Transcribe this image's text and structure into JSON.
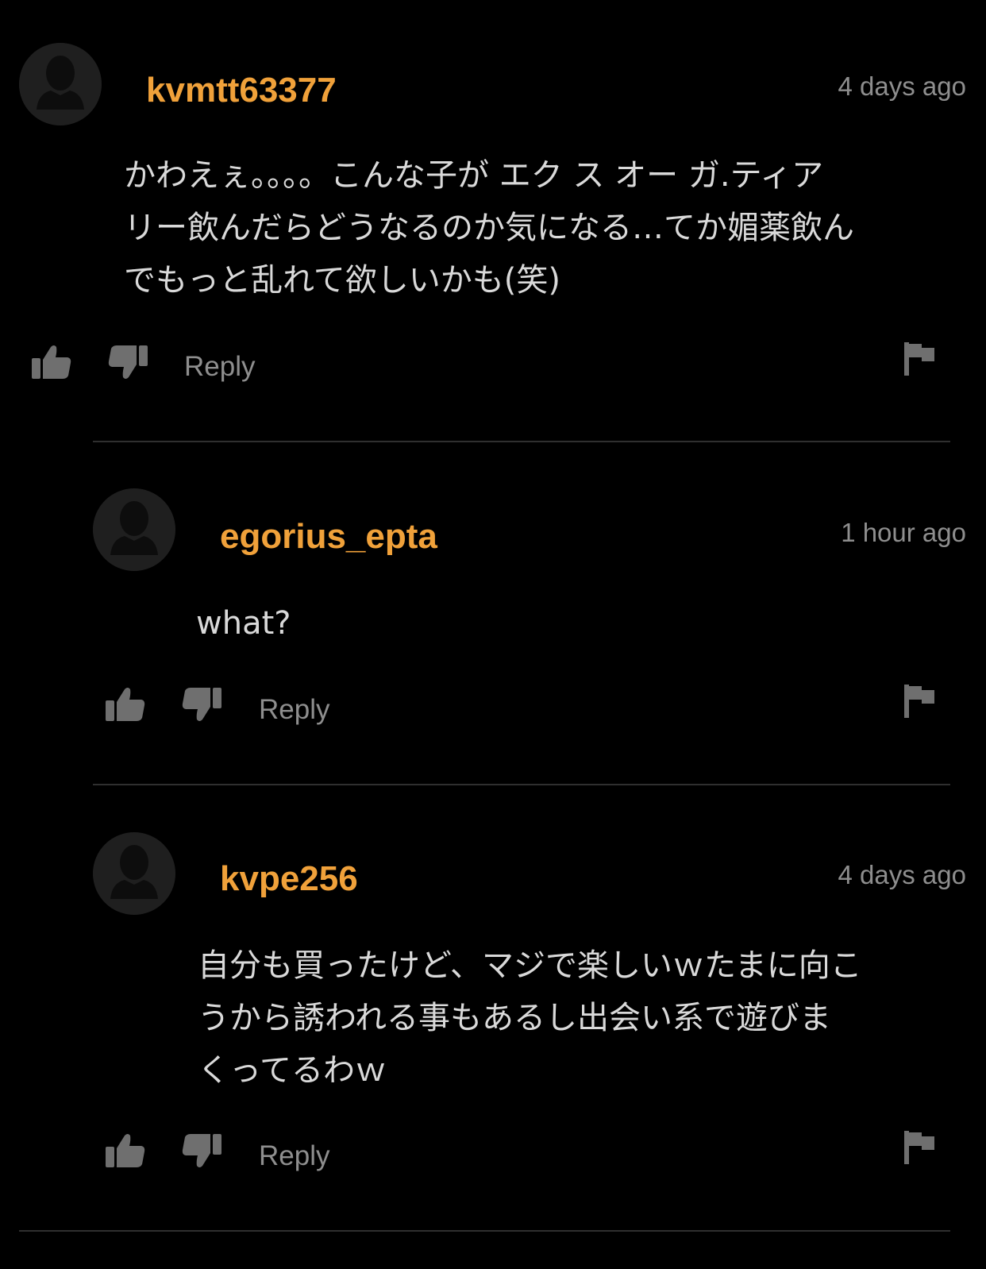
{
  "comments": [
    {
      "username": "kvmtt63377",
      "timestamp": "4 days ago",
      "text": "かわえぇ。。。。こんな子が エク ス オー ガ.ティア\nリー飲んだらどうなるのか気になる…てか媚薬飲ん\nでもっと乱れて欲しいかも(笑)",
      "reply_label": "Reply"
    },
    {
      "username": "egorius_epta",
      "timestamp": "1 hour ago",
      "text": "what?",
      "reply_label": "Reply"
    },
    {
      "username": "kvpe256",
      "timestamp": "4 days ago",
      "text": "自分も買ったけど、マジで楽しいｗたまに向こ\nうから誘われる事もあるし出会い系で遊びま\nくってるわｗ",
      "reply_label": "Reply"
    }
  ],
  "icons": {
    "avatar": "default-user-avatar-icon",
    "like": "thumbs-up-icon",
    "dislike": "thumbs-down-icon",
    "flag": "flag-icon"
  },
  "colors": {
    "background": "#000000",
    "username": "#f0a13a",
    "meta": "#8e8e8e",
    "text": "#d9d9d9",
    "icon": "#6f6f6f",
    "divider": "#2f2f2f",
    "avatar_bg": "#1f1f1f"
  }
}
